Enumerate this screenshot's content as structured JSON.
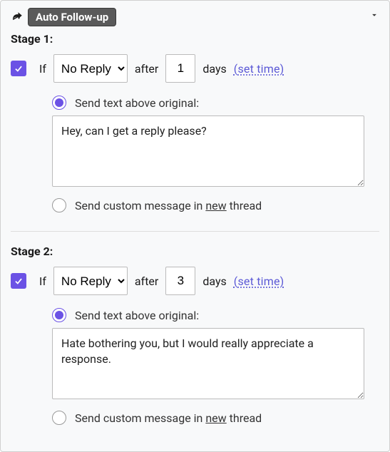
{
  "header": {
    "title": "Auto Follow-up"
  },
  "stages": [
    {
      "label": "Stage 1:",
      "enabled": true,
      "if_text": "If",
      "condition_selected": "No Reply",
      "after_text": "after",
      "days_value": "1",
      "days_text": "days",
      "set_time_label": "set time",
      "radio_selected": "above",
      "option_above_label": "Send text above original:",
      "message_value": "Hey, can I get a reply please?",
      "option_new_prefix": "Send custom message in ",
      "option_new_word": "new",
      "option_new_suffix": "   thread"
    },
    {
      "label": "Stage 2:",
      "enabled": true,
      "if_text": "If",
      "condition_selected": "No Reply",
      "after_text": "after",
      "days_value": "3",
      "days_text": "days",
      "set_time_label": "set time",
      "radio_selected": "above",
      "option_above_label": "Send text above original:",
      "message_value": "Hate bothering you, but I would really appreciate a response.",
      "option_new_prefix": "Send custom message in ",
      "option_new_word": "new",
      "option_new_suffix": "   thread"
    }
  ]
}
